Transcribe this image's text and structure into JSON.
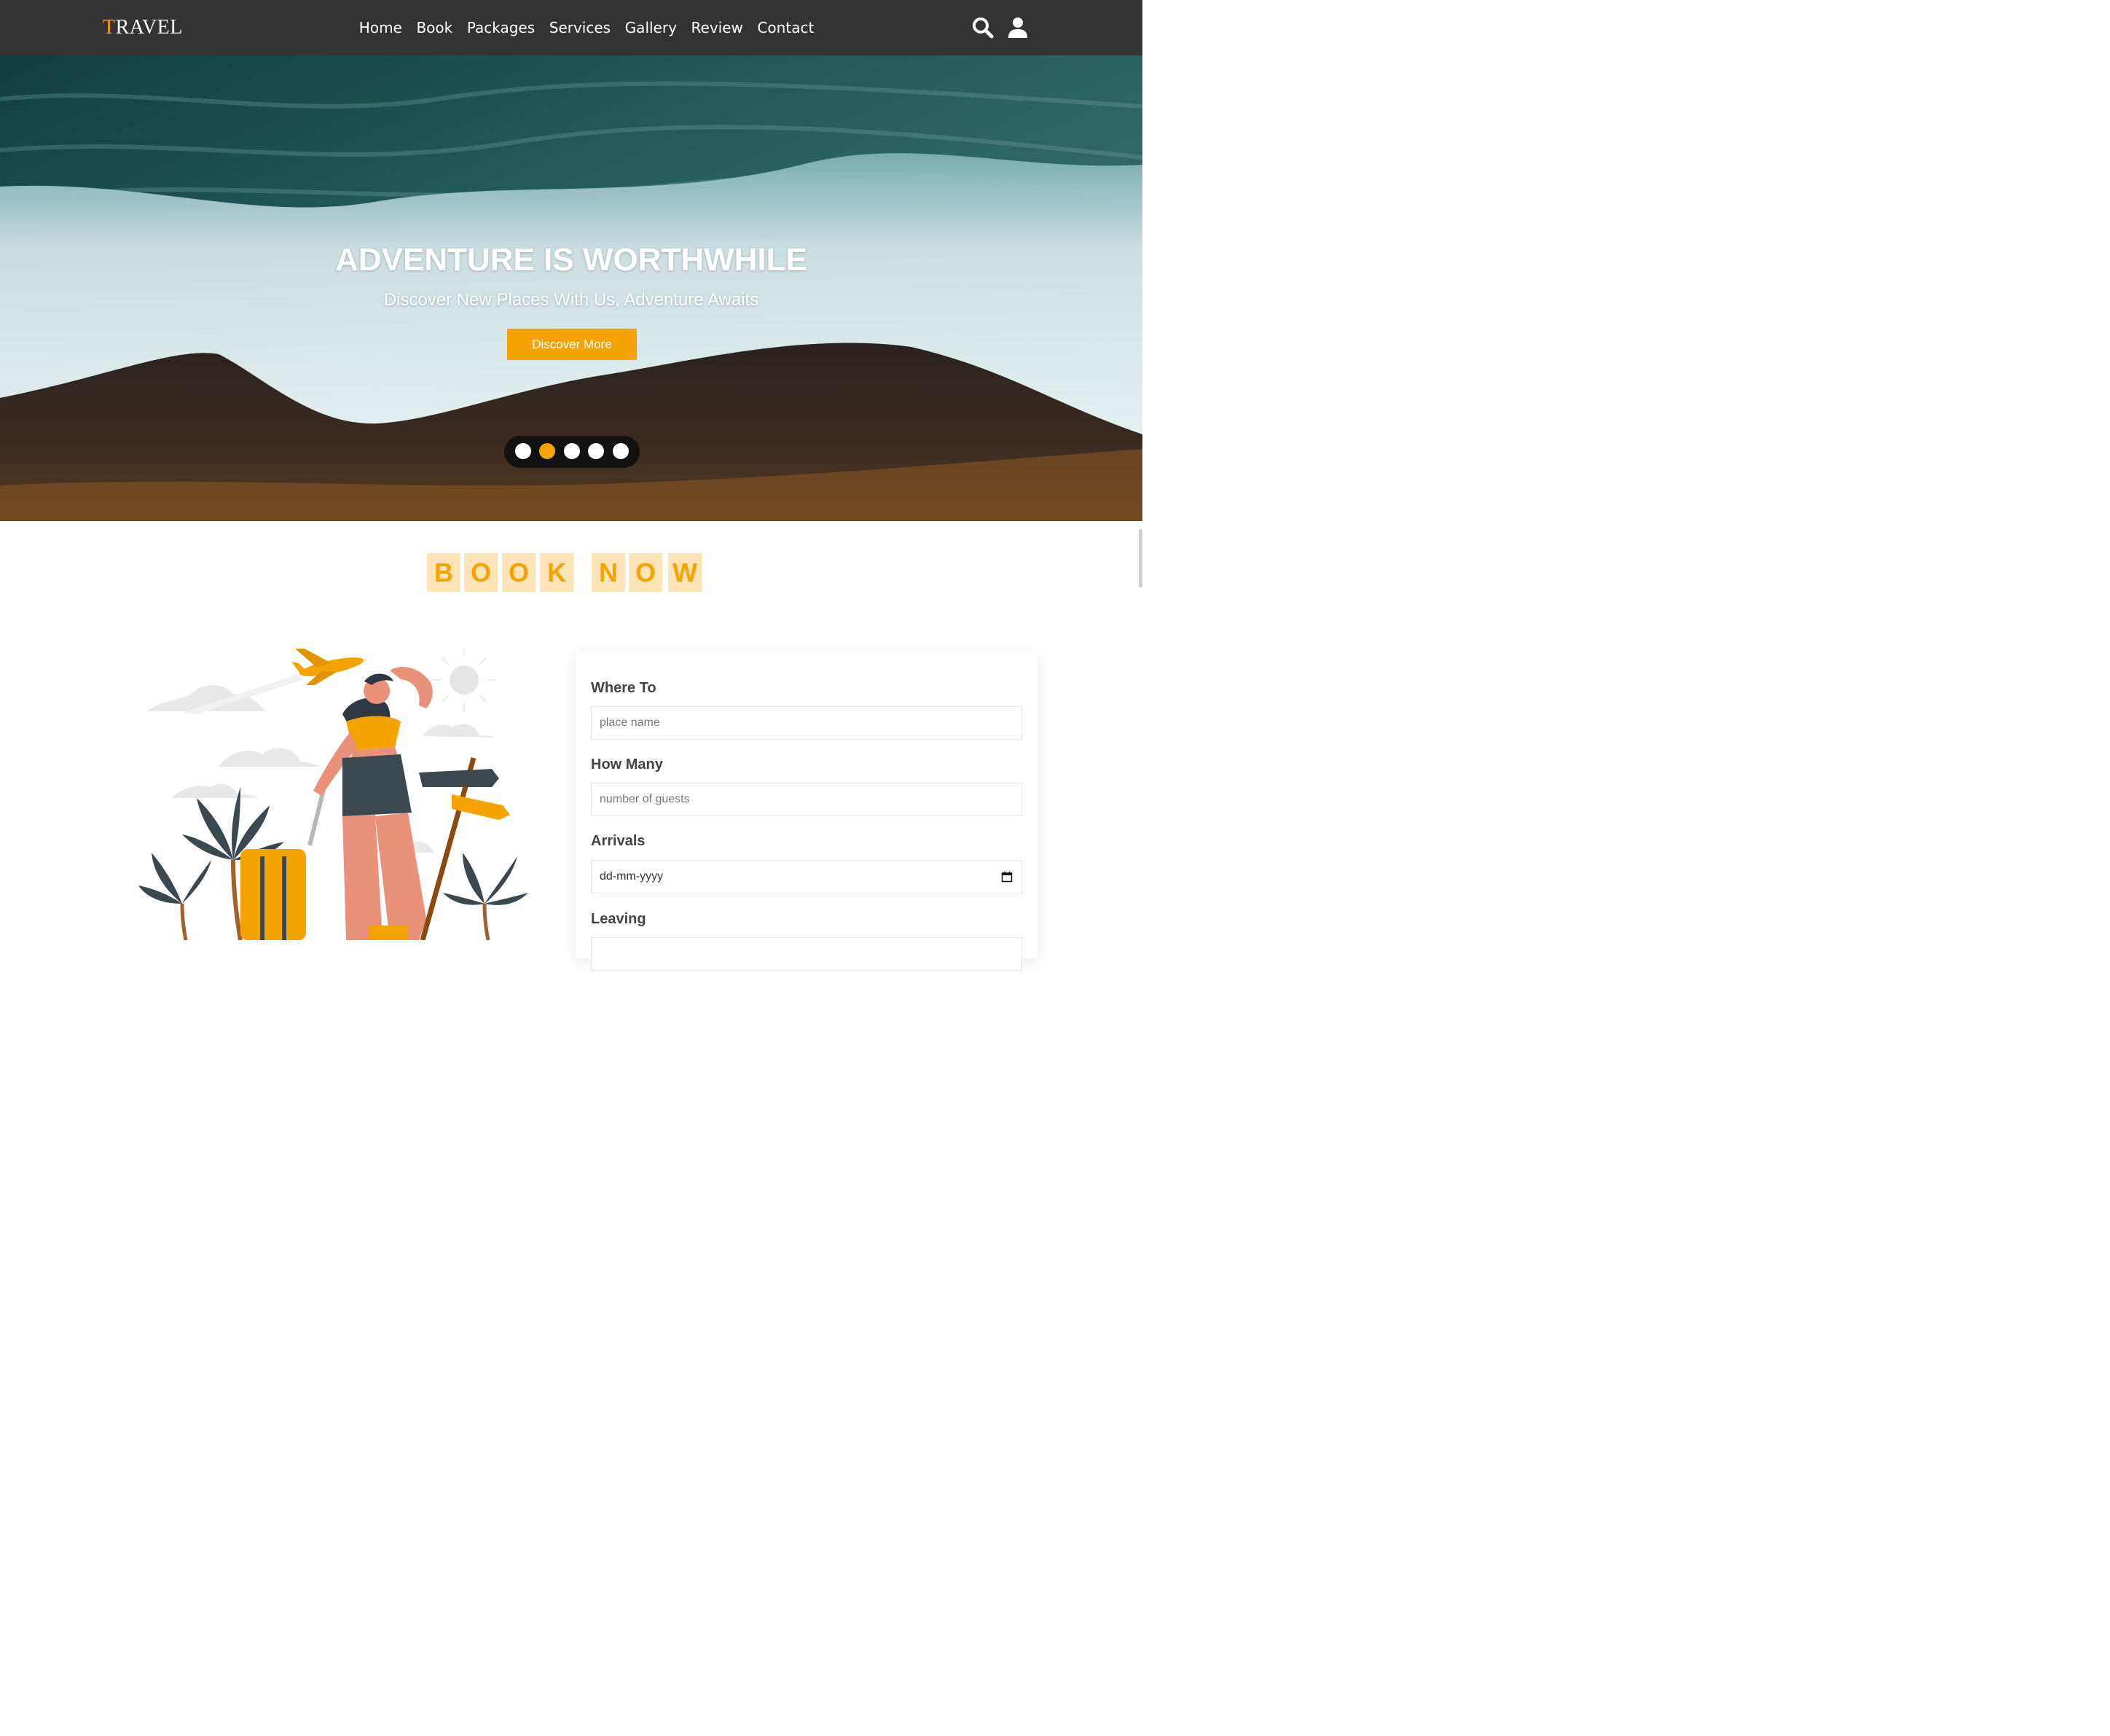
{
  "nav": {
    "logo_first": "T",
    "logo_rest": "RAVEL",
    "links": [
      "Home",
      "Book",
      "Packages",
      "Services",
      "Gallery",
      "Review",
      "Contact"
    ],
    "icons": [
      "search-icon",
      "user-icon"
    ]
  },
  "hero": {
    "title": "ADVENTURE IS WORTHWHILE",
    "subtitle": "Discover New Places With Us, Adventure Awaits",
    "button": "Discover More",
    "slide_count": 5,
    "active_slide": 2
  },
  "book": {
    "heading_letters": [
      "B",
      "O",
      "O",
      "K",
      "N",
      "O",
      "W"
    ],
    "fields": [
      {
        "label": "Where To",
        "placeholder": "place name"
      },
      {
        "label": "How Many",
        "placeholder": "number of guests"
      },
      {
        "label": "Arrivals",
        "placeholder": "dd-mm-yyyy"
      },
      {
        "label": "Leaving",
        "placeholder": ""
      }
    ]
  },
  "colors": {
    "accent": "#f5a300",
    "nav_bg": "#333333",
    "tile_bg": "#ffe4b8"
  }
}
